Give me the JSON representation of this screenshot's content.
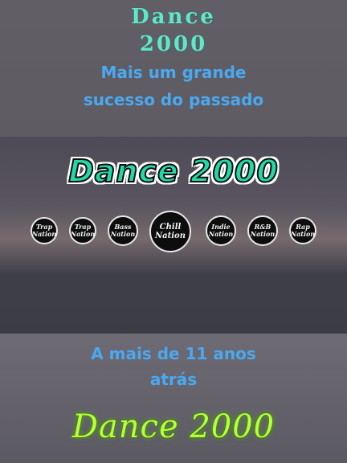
{
  "header": {
    "title_line1": "Dance",
    "title_line2": "2000",
    "subtitle_line1": "Mais um grande",
    "subtitle_line2": "sucesso do passado"
  },
  "banner": {
    "text": "Dance 2000"
  },
  "logos": [
    {
      "name": "Trap Nation",
      "line1": "Trap",
      "line2": "Nation"
    },
    {
      "name": "Trap Nation",
      "line1": "Trap",
      "line2": "Nation"
    },
    {
      "name": "Bass Nation",
      "line1": "Bass",
      "line2": "Nation"
    },
    {
      "name": "Chill Nation",
      "line1": "Chill",
      "line2": "Nation"
    },
    {
      "name": "Indie Nation",
      "line1": "Indie",
      "line2": "Nation"
    },
    {
      "name": "R&B Nation",
      "line1": "R&B",
      "line2": "Nation"
    },
    {
      "name": "Rap Nation",
      "line1": "Rap",
      "line2": "Nation"
    }
  ],
  "footer": {
    "caption_line1": "A mais de 11 anos",
    "caption_line2": "atrás",
    "signature": "Dance 2000"
  },
  "colors": {
    "title": "#5fe8c8",
    "subtitle": "#4aa9f0",
    "banner_fill": "#21d9a8",
    "signature": "#b6ff3a"
  }
}
